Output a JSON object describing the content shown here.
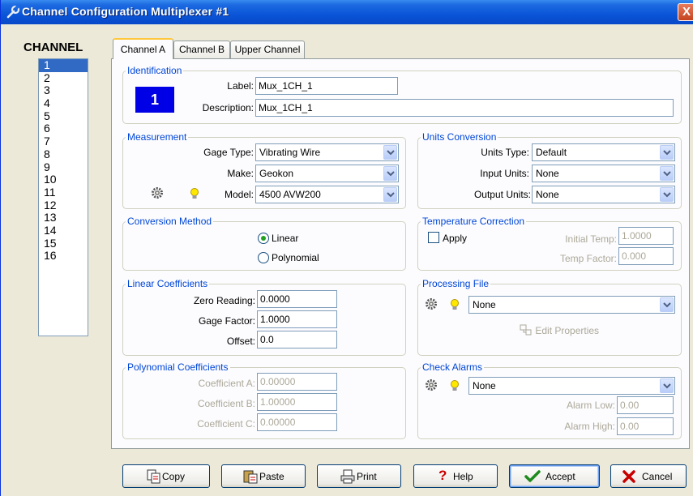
{
  "window": {
    "title": "Channel Configuration Multiplexer #1",
    "close_label": "X"
  },
  "channel_list": {
    "header": "CHANNEL",
    "items": [
      "1",
      "2",
      "3",
      "4",
      "5",
      "6",
      "7",
      "8",
      "9",
      "10",
      "11",
      "12",
      "13",
      "14",
      "15",
      "16"
    ],
    "selected": "1"
  },
  "tabs": [
    {
      "label": "Channel A",
      "active": true
    },
    {
      "label": "Channel B",
      "active": false
    },
    {
      "label": "Upper Channel",
      "active": false
    }
  ],
  "identification": {
    "legend": "Identification",
    "badge": "1",
    "label_caption": "Label:",
    "label_value": "Mux_1CH_1",
    "description_caption": "Description:",
    "description_value": "Mux_1CH_1"
  },
  "measurement": {
    "legend": "Measurement",
    "gage_type_caption": "Gage Type:",
    "gage_type_value": "Vibrating Wire",
    "make_caption": "Make:",
    "make_value": "Geokon",
    "model_caption": "Model:",
    "model_value": "4500 AVW200"
  },
  "units_conversion": {
    "legend": "Units Conversion",
    "units_type_caption": "Units Type:",
    "units_type_value": "Default",
    "input_units_caption": "Input Units:",
    "input_units_value": "None",
    "output_units_caption": "Output Units:",
    "output_units_value": "None"
  },
  "conversion_method": {
    "legend": "Conversion Method",
    "option_linear": "Linear",
    "option_polynomial": "Polynomial",
    "selected": "Linear"
  },
  "temperature_correction": {
    "legend": "Temperature Correction",
    "apply_label": "Apply",
    "apply_checked": false,
    "initial_temp_caption": "Initial Temp:",
    "initial_temp_value": "1.0000",
    "temp_factor_caption": "Temp Factor:",
    "temp_factor_value": "0.000"
  },
  "linear_coefficients": {
    "legend": "Linear Coefficients",
    "zero_reading_caption": "Zero Reading:",
    "zero_reading_value": "0.0000",
    "gage_factor_caption": "Gage Factor:",
    "gage_factor_value": "1.0000",
    "offset_caption": "Offset:",
    "offset_value": "0.0"
  },
  "processing_file": {
    "legend": "Processing File",
    "value": "None",
    "edit_properties_label": "Edit Properties"
  },
  "polynomial_coefficients": {
    "legend": "Polynomial Coefficients",
    "coef_a_caption": "Coefficient A:",
    "coef_a_value": "0.00000",
    "coef_b_caption": "Coefficient B:",
    "coef_b_value": "1.00000",
    "coef_c_caption": "Coefficient C:",
    "coef_c_value": "0.00000"
  },
  "check_alarms": {
    "legend": "Check Alarms",
    "value": "None",
    "alarm_low_caption": "Alarm Low:",
    "alarm_low_value": "0.00",
    "alarm_high_caption": "Alarm High:",
    "alarm_high_value": "0.00"
  },
  "buttons": {
    "copy": "Copy",
    "paste": "Paste",
    "print": "Print",
    "help": "Help",
    "accept": "Accept",
    "cancel": "Cancel"
  },
  "colors": {
    "title_bar": "#0a55d8",
    "group_legend": "#0046d5",
    "selection": "#316ac5",
    "badge": "#0000e6",
    "disabled_text": "#aca899"
  },
  "icons": {
    "title": "wrench-icon",
    "gear": "gear-icon",
    "bulb": "lightbulb-icon",
    "edit_properties": "properties-icon",
    "copy": "copy-icon",
    "paste": "paste-icon",
    "print": "printer-icon",
    "help": "question-mark-icon",
    "accept": "checkmark-icon",
    "cancel": "x-cross-icon"
  }
}
